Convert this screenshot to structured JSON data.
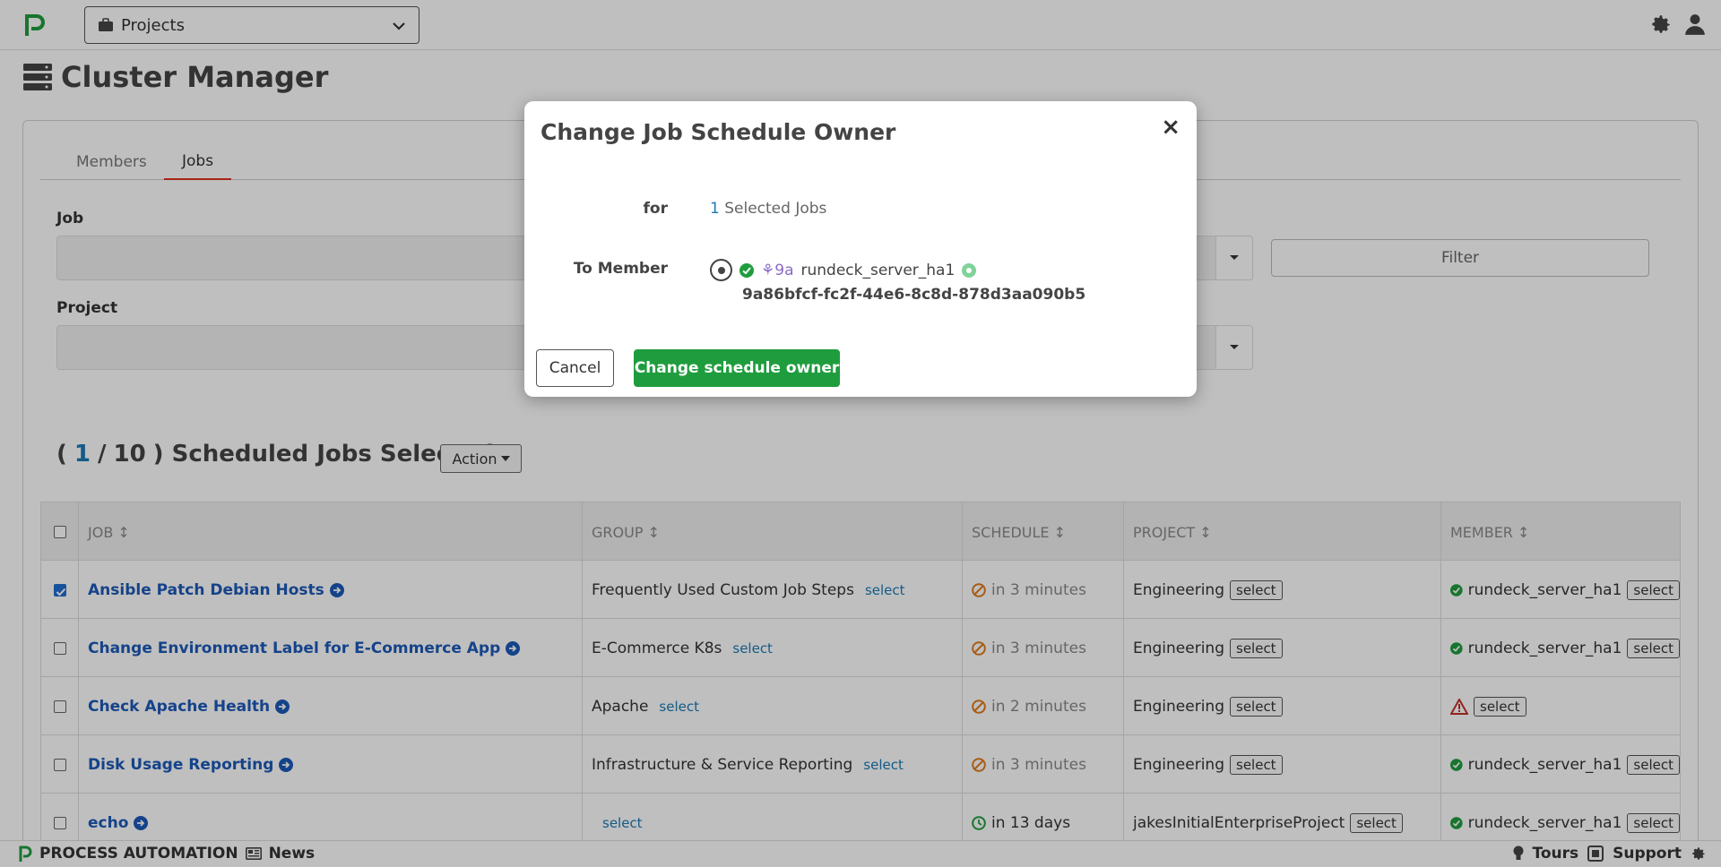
{
  "topnav": {
    "projects_label": "Projects"
  },
  "page": {
    "title": "Cluster Manager"
  },
  "tabs": [
    {
      "label": "Members",
      "active": false
    },
    {
      "label": "Jobs",
      "active": true
    }
  ],
  "filters": {
    "job_label": "Job",
    "project_label": "Project",
    "filter_button": "Filter"
  },
  "scheduled": {
    "open_paren": "(",
    "selected": "1",
    "separator": "/",
    "total": "10",
    "close_text": ") Scheduled Jobs Selected",
    "action_label": "Action"
  },
  "table": {
    "headers": [
      "JOB",
      "GROUP",
      "SCHEDULE",
      "PROJECT",
      "MEMBER"
    ],
    "rows": [
      {
        "checked": true,
        "job": "Ansible Patch Debian Hosts",
        "group": "Frequently Used Custom Job Steps",
        "group_select": "select",
        "schedule": "in 3 minutes",
        "schedule_state": "disabled",
        "project": "Engineering",
        "project_select": "select",
        "member": "rundeck_server_ha1",
        "member_state": "ok",
        "member_select": "select"
      },
      {
        "checked": false,
        "job": "Change Environment Label for E-Commerce App",
        "group": "E-Commerce K8s",
        "group_select": "select",
        "schedule": "in 3 minutes",
        "schedule_state": "disabled",
        "project": "Engineering",
        "project_select": "select",
        "member": "rundeck_server_ha1",
        "member_state": "ok",
        "member_select": "select"
      },
      {
        "checked": false,
        "job": "Check Apache Health",
        "group": "Apache",
        "group_select": "select",
        "schedule": "in 2 minutes",
        "schedule_state": "disabled",
        "project": "Engineering",
        "project_select": "select",
        "member": "",
        "member_state": "warning",
        "member_select": "select"
      },
      {
        "checked": false,
        "job": "Disk Usage Reporting",
        "group": "Infrastructure & Service Reporting",
        "group_select": "select",
        "schedule": "in 3 minutes",
        "schedule_state": "disabled",
        "project": "Engineering",
        "project_select": "select",
        "member": "rundeck_server_ha1",
        "member_state": "ok",
        "member_select": "select"
      },
      {
        "checked": false,
        "job": "echo",
        "group": "",
        "group_select": "select",
        "schedule": "in 13 days",
        "schedule_state": "scheduled",
        "project": "jakesInitialEnterpriseProject",
        "project_select": "select",
        "member": "rundeck_server_ha1",
        "member_state": "ok",
        "member_select": "select"
      }
    ]
  },
  "footer": {
    "brand": "PROCESS AUTOMATION",
    "news": "News",
    "tours": "Tours",
    "support": "Support"
  },
  "modal": {
    "title": "Change Job Schedule Owner",
    "close": "×",
    "for_label": "for",
    "for_count": "1",
    "for_text": "Selected Jobs",
    "to_member_label": "To Member",
    "member_hash": "9a",
    "member_name": "rundeck_server_ha1",
    "member_uuid": "9a86bfcf-fc2f-44e6-8c8d-878d3aa090b5",
    "cancel": "Cancel",
    "confirm": "Change schedule owner"
  },
  "colors": {
    "accent_green": "#1f9d3e",
    "link_blue": "#1d5ab8",
    "tab_underline": "#e0311c",
    "warning_orange": "#e07b1c"
  }
}
